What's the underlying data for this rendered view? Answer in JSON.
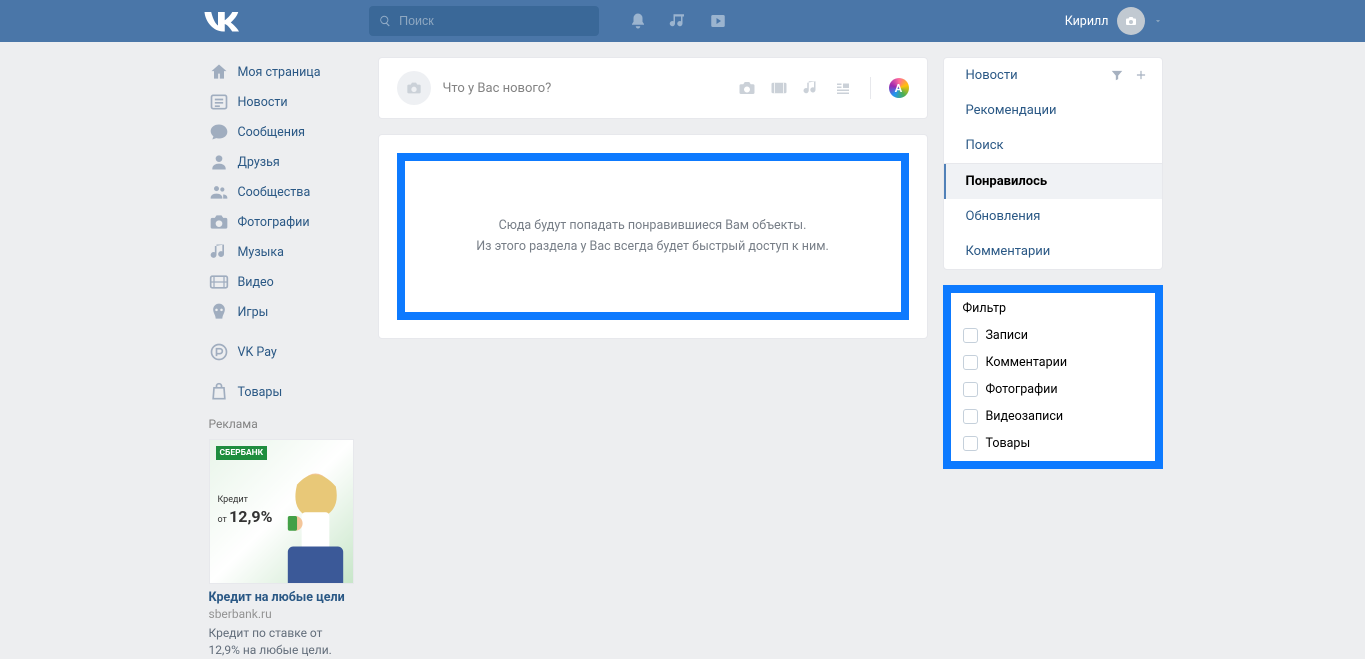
{
  "header": {
    "search_placeholder": "Поиск",
    "username": "Кирилл"
  },
  "sidebar": {
    "items": [
      {
        "label": "Моя страница",
        "icon": "home"
      },
      {
        "label": "Новости",
        "icon": "news"
      },
      {
        "label": "Сообщения",
        "icon": "msg"
      },
      {
        "label": "Друзья",
        "icon": "user"
      },
      {
        "label": "Сообщества",
        "icon": "group"
      },
      {
        "label": "Фотографии",
        "icon": "camera"
      },
      {
        "label": "Музыка",
        "icon": "music"
      },
      {
        "label": "Видео",
        "icon": "video"
      },
      {
        "label": "Игры",
        "icon": "game"
      }
    ],
    "extra1": {
      "label": "VK Pay",
      "icon": "pay"
    },
    "extra2": {
      "label": "Товары",
      "icon": "market"
    }
  },
  "ad": {
    "section_label": "Реклама",
    "brand": "СБЕРБАНК",
    "rate_prefix": "Кредит",
    "rate_from": "от",
    "rate_value": "12,9%",
    "title": "Кредит на любые цели",
    "domain": "sberbank.ru",
    "desc": "Кредит по ставке от 12,9% на любые цели."
  },
  "composer": {
    "placeholder": "Что у Вас нового?"
  },
  "empty": {
    "line1": "Сюда будут попадать понравившиеся Вам объекты.",
    "line2": "Из этого раздела у Вас всегда будет быстрый доступ к ним."
  },
  "right_tabs": {
    "news": "Новости",
    "recs": "Рекомендации",
    "search": "Поиск",
    "liked": "Понравилось",
    "updates": "Обновления",
    "comments": "Комментарии"
  },
  "filter": {
    "title": "Фильтр",
    "items": [
      "Записи",
      "Комментарии",
      "Фотографии",
      "Видеозаписи",
      "Товары"
    ]
  }
}
